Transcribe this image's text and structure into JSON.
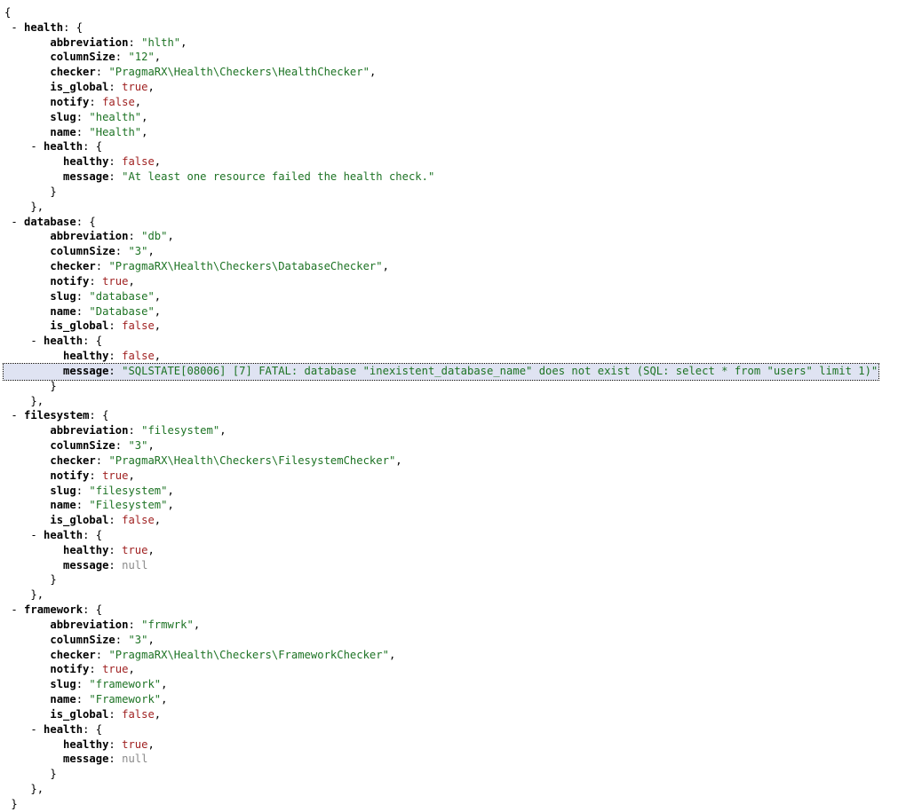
{
  "dump": {
    "root_open": "{",
    "root_close": "}",
    "sections": [
      {
        "name": "health",
        "properties": [
          {
            "key": "abbreviation",
            "value": "\"hlth\"",
            "type": "str",
            "comma": true
          },
          {
            "key": "columnSize",
            "value": "\"12\"",
            "type": "str",
            "comma": true
          },
          {
            "key": "checker",
            "value": "\"PragmaRX\\Health\\Checkers\\HealthChecker\"",
            "type": "str",
            "comma": true
          },
          {
            "key": "is_global",
            "value": "true",
            "type": "bool",
            "comma": true
          },
          {
            "key": "notify",
            "value": "false",
            "type": "bool",
            "comma": true
          },
          {
            "key": "slug",
            "value": "\"health\"",
            "type": "str",
            "comma": true
          },
          {
            "key": "name",
            "value": "\"Health\"",
            "type": "str",
            "comma": true
          }
        ],
        "health": {
          "label": "health",
          "healthy": {
            "key": "healthy",
            "value": "false",
            "type": "bool",
            "comma": true
          },
          "message": {
            "key": "message",
            "value": "\"At least one resource failed the health check.\"",
            "type": "str",
            "comma": false,
            "selected": false
          }
        }
      },
      {
        "name": "database",
        "properties": [
          {
            "key": "abbreviation",
            "value": "\"db\"",
            "type": "str",
            "comma": true
          },
          {
            "key": "columnSize",
            "value": "\"3\"",
            "type": "str",
            "comma": true
          },
          {
            "key": "checker",
            "value": "\"PragmaRX\\Health\\Checkers\\DatabaseChecker\"",
            "type": "str",
            "comma": true
          },
          {
            "key": "notify",
            "value": "true",
            "type": "bool",
            "comma": true
          },
          {
            "key": "slug",
            "value": "\"database\"",
            "type": "str",
            "comma": true
          },
          {
            "key": "name",
            "value": "\"Database\"",
            "type": "str",
            "comma": true
          },
          {
            "key": "is_global",
            "value": "false",
            "type": "bool",
            "comma": true
          }
        ],
        "health": {
          "label": "health",
          "healthy": {
            "key": "healthy",
            "value": "false",
            "type": "bool",
            "comma": true
          },
          "message": {
            "key": "message",
            "value": "\"SQLSTATE[08006] [7] FATAL: database \"inexistent_database_name\" does not exist (SQL: select * from \"users\" limit 1)\"",
            "type": "str",
            "comma": false,
            "selected": true
          }
        }
      },
      {
        "name": "filesystem",
        "properties": [
          {
            "key": "abbreviation",
            "value": "\"filesystem\"",
            "type": "str",
            "comma": true
          },
          {
            "key": "columnSize",
            "value": "\"3\"",
            "type": "str",
            "comma": true
          },
          {
            "key": "checker",
            "value": "\"PragmaRX\\Health\\Checkers\\FilesystemChecker\"",
            "type": "str",
            "comma": true
          },
          {
            "key": "notify",
            "value": "true",
            "type": "bool",
            "comma": true
          },
          {
            "key": "slug",
            "value": "\"filesystem\"",
            "type": "str",
            "comma": true
          },
          {
            "key": "name",
            "value": "\"Filesystem\"",
            "type": "str",
            "comma": true
          },
          {
            "key": "is_global",
            "value": "false",
            "type": "bool",
            "comma": true
          }
        ],
        "health": {
          "label": "health",
          "healthy": {
            "key": "healthy",
            "value": "true",
            "type": "bool",
            "comma": true
          },
          "message": {
            "key": "message",
            "value": "null",
            "type": "null",
            "comma": false,
            "selected": false
          }
        }
      },
      {
        "name": "framework",
        "properties": [
          {
            "key": "abbreviation",
            "value": "\"frmwrk\"",
            "type": "str",
            "comma": true
          },
          {
            "key": "columnSize",
            "value": "\"3\"",
            "type": "str",
            "comma": true
          },
          {
            "key": "checker",
            "value": "\"PragmaRX\\Health\\Checkers\\FrameworkChecker\"",
            "type": "str",
            "comma": true
          },
          {
            "key": "notify",
            "value": "true",
            "type": "bool",
            "comma": true
          },
          {
            "key": "slug",
            "value": "\"framework\"",
            "type": "str",
            "comma": true
          },
          {
            "key": "name",
            "value": "\"Framework\"",
            "type": "str",
            "comma": true
          },
          {
            "key": "is_global",
            "value": "false",
            "type": "bool",
            "comma": true
          }
        ],
        "health": {
          "label": "health",
          "healthy": {
            "key": "healthy",
            "value": "true",
            "type": "bool",
            "comma": true
          },
          "message": {
            "key": "message",
            "value": "null",
            "type": "null",
            "comma": false,
            "selected": false
          }
        }
      }
    ]
  }
}
